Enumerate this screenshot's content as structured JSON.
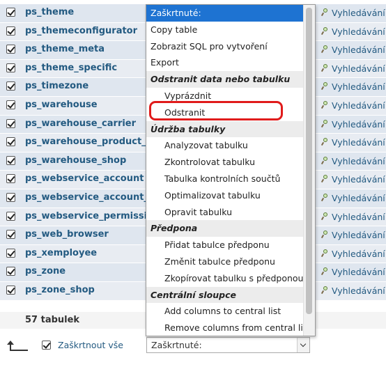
{
  "tables": [
    {
      "name": "ps_theme",
      "action": "Vyhledávání"
    },
    {
      "name": "ps_themeconfigurator",
      "action": "Vyhledávání"
    },
    {
      "name": "ps_theme_meta",
      "action": "Vyhledávání"
    },
    {
      "name": "ps_theme_specific",
      "action": "Vyhledávání"
    },
    {
      "name": "ps_timezone",
      "action": "Vyhledávání"
    },
    {
      "name": "ps_warehouse",
      "action": "Vyhledávání"
    },
    {
      "name": "ps_warehouse_carrier",
      "action": "Vyhledávání"
    },
    {
      "name": "ps_warehouse_product_location",
      "action": "Vyhledávání"
    },
    {
      "name": "ps_warehouse_shop",
      "action": "Vyhledávání"
    },
    {
      "name": "ps_webservice_account",
      "action": "Vyhledávání"
    },
    {
      "name": "ps_webservice_account_shop",
      "action": "Vyhledávání"
    },
    {
      "name": "ps_webservice_permission",
      "action": "Vyhledávání"
    },
    {
      "name": "ps_web_browser",
      "action": "Vyhledávání"
    },
    {
      "name": "ps_xemployee",
      "action": "Vyhledávání"
    },
    {
      "name": "ps_zone",
      "action": "Vyhledávání"
    },
    {
      "name": "ps_zone_shop",
      "action": "Vyhledávání"
    }
  ],
  "summary": "57 tabulek",
  "bottom": {
    "check_all_label": "Zaškrtnout vše",
    "select_value": "Zaškrtnuté:"
  },
  "dropdown": {
    "items": [
      {
        "label": "Zaškrtnuté:",
        "kind": "selected"
      },
      {
        "label": "Copy table",
        "kind": "option"
      },
      {
        "label": "Zobrazit SQL pro vytvoření",
        "kind": "option"
      },
      {
        "label": "Export",
        "kind": "option"
      },
      {
        "label": "Odstranit data nebo tabulku",
        "kind": "group"
      },
      {
        "label": "Vyprázdnit",
        "kind": "indent"
      },
      {
        "label": "Odstranit",
        "kind": "indent"
      },
      {
        "label": "Údržba tabulky",
        "kind": "group"
      },
      {
        "label": "Analyzovat tabulku",
        "kind": "indent"
      },
      {
        "label": "Zkontrolovat tabulku",
        "kind": "indent"
      },
      {
        "label": "Tabulka kontrolních součtů",
        "kind": "indent"
      },
      {
        "label": "Optimalizovat tabulku",
        "kind": "indent"
      },
      {
        "label": "Opravit tabulku",
        "kind": "indent"
      },
      {
        "label": "Předpona",
        "kind": "group"
      },
      {
        "label": "Přidat tabulce předponu",
        "kind": "indent"
      },
      {
        "label": "Změnit tabulce předponu",
        "kind": "indent"
      },
      {
        "label": "Zkopírovat tabulku s předponou",
        "kind": "indent"
      },
      {
        "label": "Centrální sloupce",
        "kind": "group"
      },
      {
        "label": "Add columns to central list",
        "kind": "indent"
      },
      {
        "label": "Remove columns from central list",
        "kind": "indent"
      }
    ]
  },
  "colors": {
    "link": "#235a81",
    "selected_bg": "#1e73d2",
    "highlight": "#e01b1b"
  }
}
